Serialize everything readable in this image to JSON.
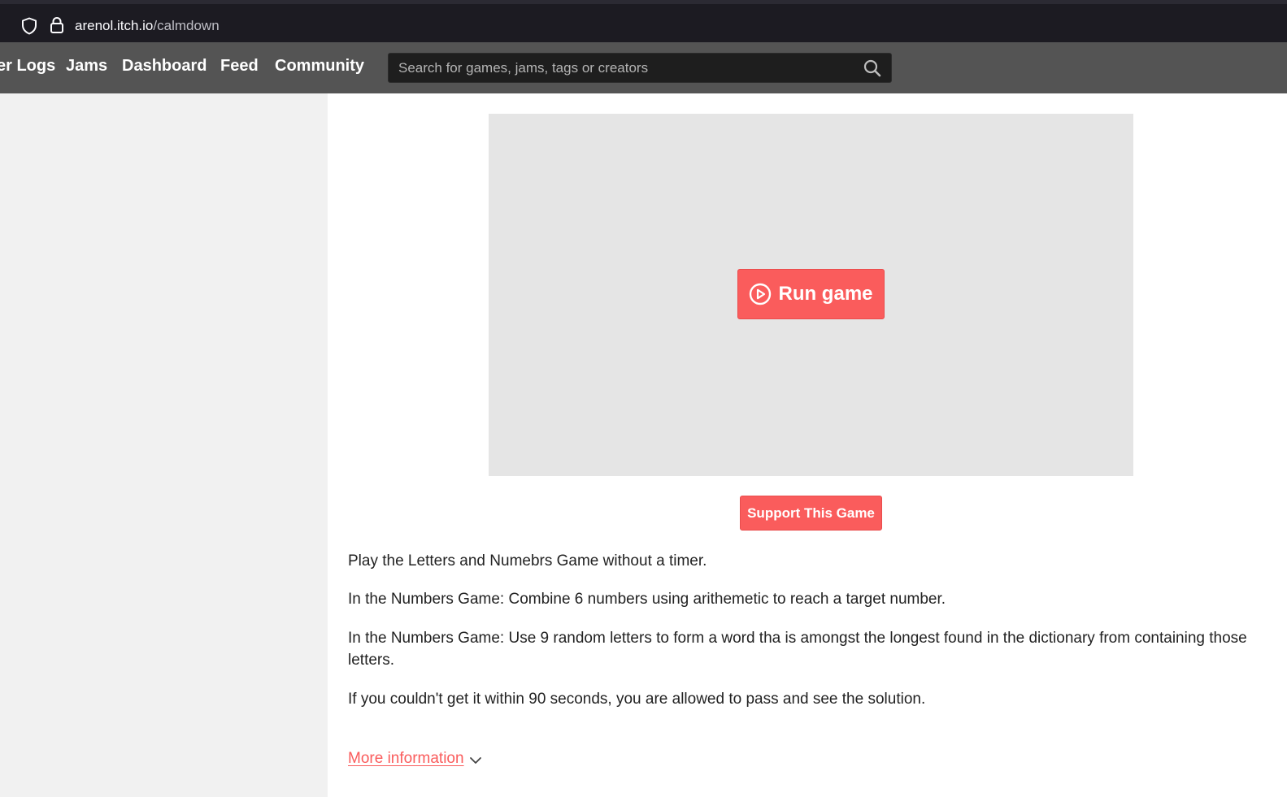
{
  "browser": {
    "url_host": "arenol.itch.io",
    "url_path": "/calmdown"
  },
  "nav": {
    "items": [
      {
        "label": "er Logs"
      },
      {
        "label": "Jams"
      },
      {
        "label": "Dashboard"
      },
      {
        "label": "Feed"
      },
      {
        "label": "Community"
      }
    ]
  },
  "search": {
    "placeholder": "Search for games, jams, tags or creators"
  },
  "game": {
    "run_label": "Run game",
    "support_label": "Support This Game"
  },
  "description": {
    "paragraphs": [
      "Play the Letters and Numebrs Game without a timer.",
      "In the Numbers Game: Combine 6 numbers using arithemetic to reach a target number.",
      "In the Numbers Game: Use 9 random letters to form a word tha is amongst the longest found in the dictionary from containing those letters.",
      "If you couldn't get it within 90 seconds, you are allowed to pass and see the solution."
    ]
  },
  "more_info": {
    "label": "More information"
  },
  "colors": {
    "accent": "#fa5c5c",
    "header_bg": "#545454",
    "browser_bg": "#1c1b22"
  }
}
